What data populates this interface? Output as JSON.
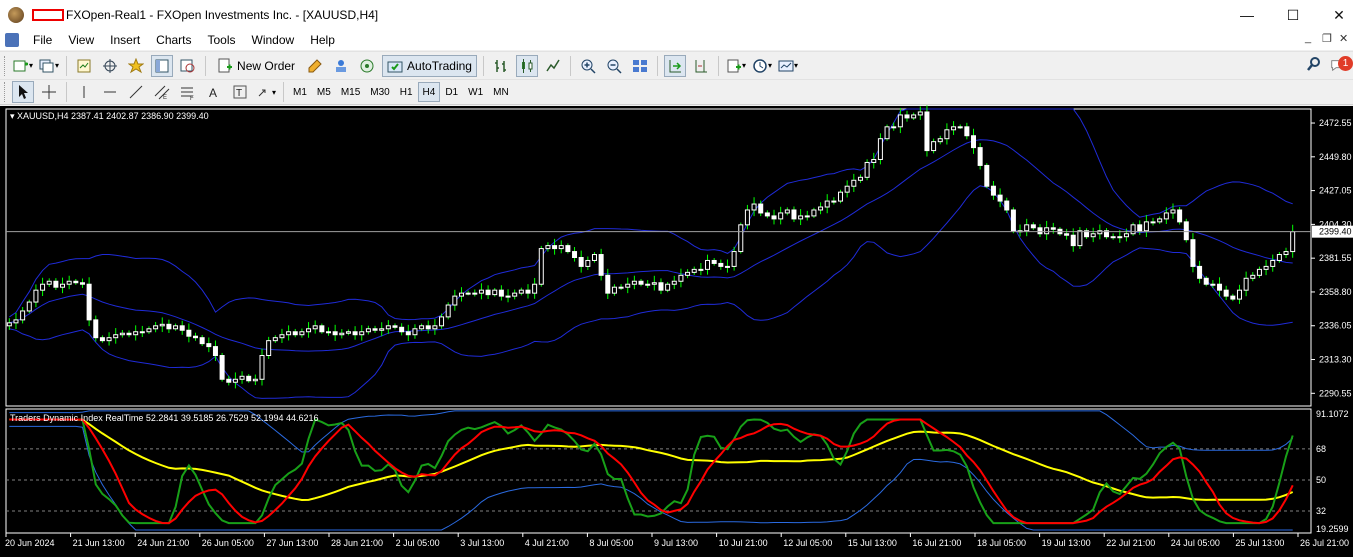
{
  "window": {
    "title": "FXOpen-Real1 - FXOpen Investments Inc. - [XAUUSD,H4]",
    "minimize": "—",
    "maximize": "☐",
    "close": "✕"
  },
  "menu": {
    "items": [
      "File",
      "View",
      "Insert",
      "Charts",
      "Tools",
      "Window",
      "Help"
    ]
  },
  "toolbar": {
    "new_order": "New Order",
    "autotrading": "AutoTrading",
    "notification_count": "1",
    "timeframes": [
      "M1",
      "M5",
      "M15",
      "M30",
      "H1",
      "H4",
      "D1",
      "W1",
      "MN"
    ],
    "active_timeframe": "H4"
  },
  "chart": {
    "symbol_info": "XAUUSD,H4  2387.41 2402.87 2386.90 2399.40",
    "current_price": "2399.40",
    "price_ticks": [
      "2472.55",
      "2449.80",
      "2427.05",
      "2404.30",
      "2381.55",
      "2358.80",
      "2336.05",
      "2313.30",
      "2290.55"
    ],
    "indicator_info": "Traders Dynamic Index RealTime 52.2841 39.5185 26.7529 52.1994 44.6216",
    "indicator_ticks": [
      "91.1072",
      "68",
      "50",
      "32",
      "19.2599"
    ],
    "time_ticks": [
      "20 Jun 2024",
      "21 Jun 13:00",
      "24 Jun 21:00",
      "26 Jun 05:00",
      "27 Jun 13:00",
      "28 Jun 21:00",
      "2 Jul 05:00",
      "3 Jul 13:00",
      "4 Jul 21:00",
      "8 Jul 05:00",
      "9 Jul 13:00",
      "10 Jul 21:00",
      "12 Jul 05:00",
      "15 Jul 13:00",
      "16 Jul 21:00",
      "18 Jul 05:00",
      "19 Jul 13:00",
      "22 Jul 21:00",
      "24 Jul 05:00",
      "25 Jul 13:00",
      "26 Jul 21:00"
    ],
    "colors": {
      "bull": "#ffffff",
      "bear": "#ffffff",
      "wick": "#00ff00",
      "band": "#1f2bd8",
      "tdi_green": "#18a018",
      "tdi_red": "#ff0000",
      "tdi_yellow": "#ffff00",
      "tdi_band": "#2a6ae0"
    }
  },
  "chart_data": {
    "type": "candlestick",
    "title": "XAUUSD,H4",
    "ylim": [
      2282,
      2482
    ],
    "closes": [
      2338,
      2340,
      2346,
      2352,
      2360,
      2364,
      2366,
      2362,
      2364,
      2366,
      2365,
      2364,
      2340,
      2328,
      2326,
      2328,
      2330,
      2331,
      2330,
      2332,
      2332,
      2334,
      2336,
      2337,
      2334,
      2336,
      2333,
      2329,
      2328,
      2324,
      2322,
      2316,
      2300,
      2298,
      2300,
      2302,
      2299,
      2300,
      2316,
      2326,
      2328,
      2330,
      2332,
      2330,
      2332,
      2334,
      2336,
      2332,
      2332,
      2330,
      2331,
      2332,
      2330,
      2332,
      2334,
      2333,
      2334,
      2336,
      2335,
      2332,
      2330,
      2334,
      2336,
      2334,
      2336,
      2342,
      2350,
      2356,
      2358,
      2358,
      2358,
      2360,
      2357,
      2360,
      2356,
      2356,
      2358,
      2360,
      2358,
      2364,
      2388,
      2390,
      2388,
      2390,
      2386,
      2382,
      2376,
      2380,
      2384,
      2370,
      2358,
      2362,
      2362,
      2364,
      2366,
      2364,
      2364,
      2365,
      2360,
      2364,
      2366,
      2370,
      2372,
      2374,
      2374,
      2380,
      2378,
      2376,
      2376,
      2386,
      2404,
      2414,
      2418,
      2412,
      2410,
      2408,
      2412,
      2414,
      2408,
      2410,
      2410,
      2414,
      2416,
      2420,
      2420,
      2426,
      2430,
      2434,
      2436,
      2446,
      2448,
      2462,
      2470,
      2470,
      2478,
      2476,
      2478,
      2480,
      2454,
      2460,
      2462,
      2468,
      2470,
      2470,
      2464,
      2456,
      2444,
      2430,
      2424,
      2420,
      2414,
      2400,
      2400,
      2404,
      2402,
      2398,
      2402,
      2401,
      2398,
      2397,
      2390,
      2400,
      2396,
      2398,
      2400,
      2396,
      2396,
      2396,
      2398,
      2404,
      2400,
      2406,
      2406,
      2408,
      2412,
      2414,
      2406,
      2394,
      2376,
      2368,
      2364,
      2364,
      2360,
      2356,
      2354,
      2360,
      2368,
      2370,
      2374,
      2376,
      2380,
      2384,
      2386,
      2399.4
    ]
  }
}
